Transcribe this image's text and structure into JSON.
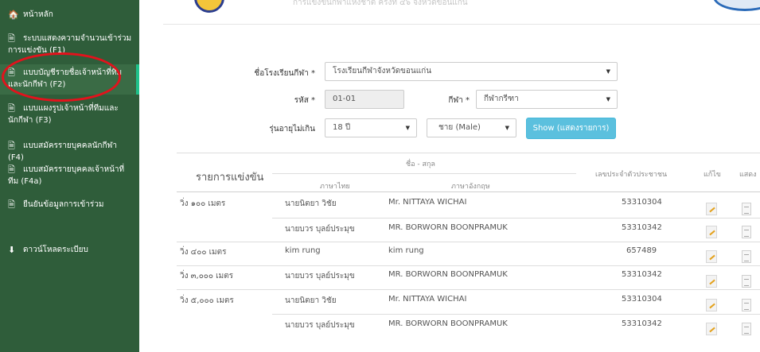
{
  "sidebar": {
    "items": [
      {
        "icon": "home-icon",
        "glyph": "🏠",
        "label": "หน้าหลัก"
      },
      {
        "icon": "document-icon",
        "glyph": "🗎",
        "label": "ระบบแสดงความจำนวนเข้าร่วมการแข่งขัน (F1)"
      },
      {
        "icon": "document-icon",
        "glyph": "🗎",
        "label": "แบบบัญชีรายชื่อเจ้าหน้าที่ทีมและนักกีฬา (F2)"
      },
      {
        "icon": "document-icon",
        "glyph": "🗎",
        "label": "แบบแผงรูปเจ้าหน้าที่ทีมและนักกีฬา (F3)"
      },
      {
        "icon": "document-icon",
        "glyph": "🗎",
        "label": "แบบสมัครรายบุคคลนักกีฬา (F4)"
      },
      {
        "icon": "document-icon",
        "glyph": "🗎",
        "label": "แบบสมัครรายบุคคลเจ้าหน้าที่ทีม (F4a)"
      },
      {
        "icon": "document-icon",
        "glyph": "🗎",
        "label": "ยืนยันข้อมูลการเข้าร่วม"
      },
      {
        "icon": "download-icon",
        "glyph": "⬇",
        "label": "ดาวน์โหลดระเบียบ"
      }
    ]
  },
  "header": {
    "subtitle": "การแข่งขันกีฬาแห่งชาติ ครั้งที่ ๔๖ จังหวัดขอนแก่น"
  },
  "form": {
    "school_label": "ชื่อโรงเรียนกีฬา *",
    "school_value": "โรงเรียนกีฬาจังหวัดขอนแก่น",
    "code_label": "รหัส *",
    "code_value": "01-01",
    "sport_label": "กีฬา *",
    "sport_value": "กีฬากรีฑา",
    "age_label": "รุ่นอายุไม่เกิน",
    "age_value": "18 ปี",
    "gender_value": "ชาย (Male)",
    "show_button": "Show (แสดงรายการ)"
  },
  "table": {
    "title": "รายการแข่งขัน",
    "name_header": "ชื่อ - สกุล",
    "thai_header": "ภาษาไทย",
    "english_header": "ภาษาอังกฤษ",
    "id_header": "เลขประจำตัวประชาชน",
    "edit_header": "แก้ไข",
    "view_header": "แสดง",
    "rows": [
      {
        "event": "วิ่ง ๑๐๐ เมตร",
        "thai": "นายนิตยา วิชัย",
        "english": "Mr. NITTAYA WICHAI",
        "id": "53310304"
      },
      {
        "event": "",
        "thai": "นายบวร บุลย์ประมุข",
        "english": "MR. BORWORN BOONPRAMUK",
        "id": "53310342"
      },
      {
        "event": "วิ่ง ๔๐๐ เมตร",
        "thai": "kim rung",
        "english": "kim rung",
        "id": "657489"
      },
      {
        "event": "วิ่ง ๓,๐๐๐ เมตร",
        "thai": "นายบวร บุลย์ประมุข",
        "english": "MR. BORWORN BOONPRAMUK",
        "id": "53310342"
      },
      {
        "event": "วิ่ง ๕,๐๐๐ เมตร",
        "thai": "นายนิตยา วิชัย",
        "english": "Mr. NITTAYA WICHAI",
        "id": "53310304"
      },
      {
        "event": "",
        "thai": "นายบวร บุลย์ประมุข",
        "english": "MR. BORWORN BOONPRAMUK",
        "id": "53310342"
      }
    ]
  }
}
